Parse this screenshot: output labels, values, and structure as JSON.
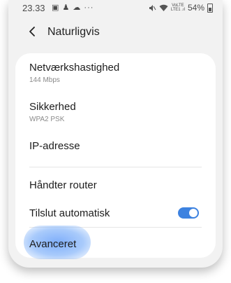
{
  "status_bar": {
    "time": "23.33",
    "left_icons": "▣ ♟ ☁ ···",
    "network_label_top": "VoLTE",
    "network_label_bottom": "LTE1 .ıl",
    "battery_percent": "54%"
  },
  "header": {
    "back_icon": "chevron-left-icon",
    "title": "Naturligvis"
  },
  "items": [
    {
      "title": "Netværkshastighed",
      "subtitle": "144 Mbps"
    },
    {
      "title": "Sikkerhed",
      "subtitle": "WPA2 PSK"
    },
    {
      "title": "IP-adresse"
    },
    {
      "title": "Håndter router"
    },
    {
      "title": "Tilslut automatisk",
      "toggle_on": true
    },
    {
      "title": "Avanceret"
    }
  ],
  "colors": {
    "accent": "#3d82e0",
    "highlight": "#8ab8f8"
  }
}
